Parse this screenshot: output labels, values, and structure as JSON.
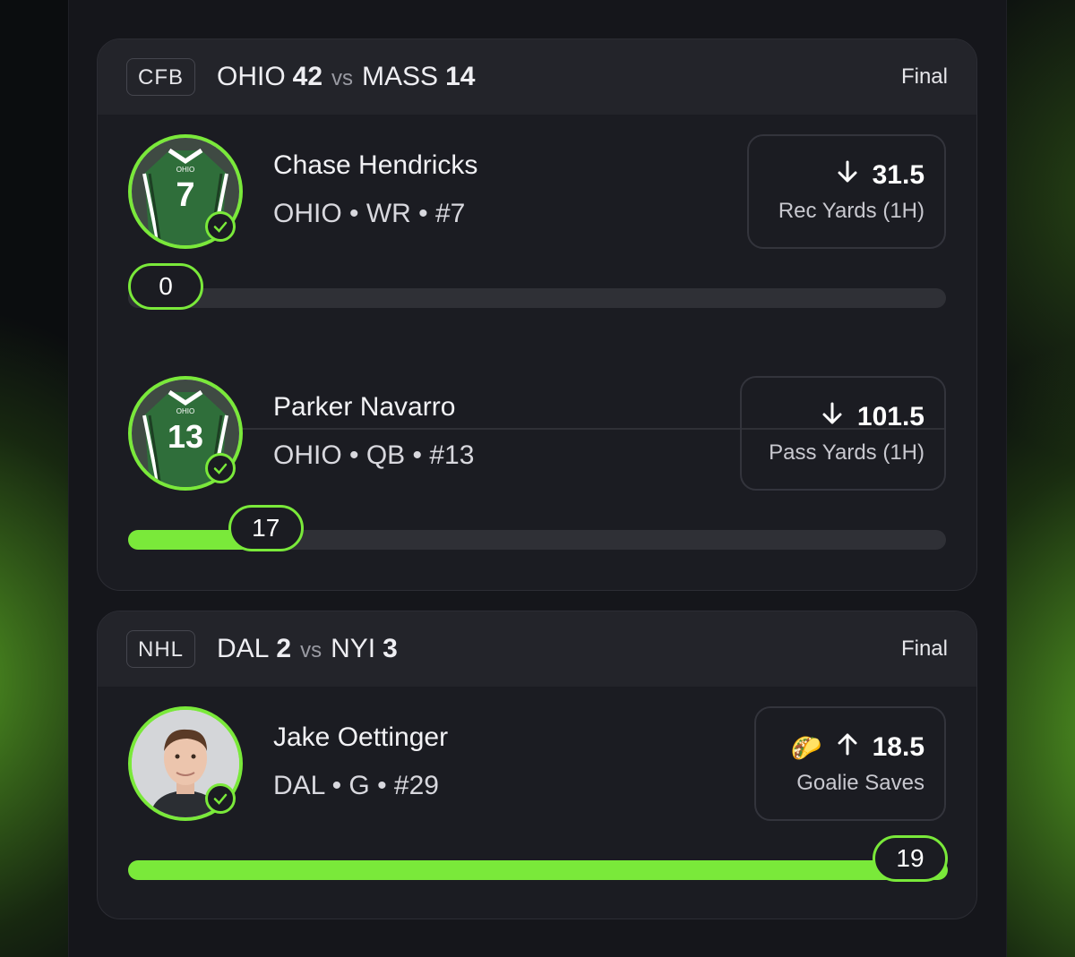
{
  "colors": {
    "accent": "#7ae93a",
    "card": "#1b1c22",
    "header": "#23242a"
  },
  "cards": [
    {
      "league": "CFB",
      "team1": "OHIO",
      "score1": "42",
      "vs": "vs",
      "team2": "MASS",
      "score2": "14",
      "status": "Final",
      "players": [
        {
          "name": "Chase Hendricks",
          "info": "OHIO • WR • #7",
          "jersey_number": "7",
          "jersey_text": "OHIO",
          "direction": "down",
          "line": "31.5",
          "stat": "Rec Yards (1H)",
          "actual": "0",
          "progress": 0.0
        },
        {
          "name": "Parker Navarro",
          "info": "OHIO • QB • #13",
          "jersey_number": "13",
          "jersey_text": "OHIO",
          "direction": "down",
          "line": "101.5",
          "stat": "Pass Yards (1H)",
          "actual": "17",
          "progress": 0.168
        }
      ]
    },
    {
      "league": "NHL",
      "team1": "DAL",
      "score1": "2",
      "vs": "vs",
      "team2": "NYI",
      "score2": "3",
      "status": "Final",
      "players": [
        {
          "name": "Jake Oettinger",
          "info": "DAL • G • #29",
          "direction": "up",
          "line": "18.5",
          "stat": "Goalie Saves",
          "emoji": "🌮",
          "actual": "19",
          "progress": 1.0
        }
      ]
    }
  ]
}
